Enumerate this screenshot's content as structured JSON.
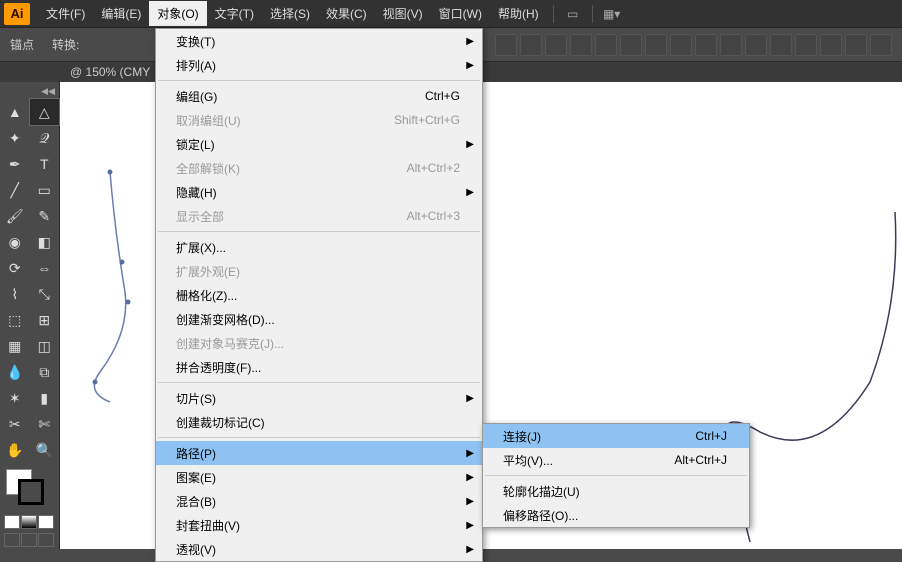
{
  "app_logo": "Ai",
  "menubar": [
    "文件(F)",
    "编辑(E)",
    "对象(O)",
    "文字(T)",
    "选择(S)",
    "效果(C)",
    "视图(V)",
    "窗口(W)",
    "帮助(H)"
  ],
  "active_menu_index": 2,
  "options": {
    "anchor": "锚点",
    "convert": "转换:"
  },
  "doc_tab": {
    "label": "@ 150% (CMY",
    "close": "×"
  },
  "dropdown": [
    {
      "t": "item",
      "label": "变换(T)",
      "arrow": true
    },
    {
      "t": "item",
      "label": "排列(A)",
      "arrow": true
    },
    {
      "t": "sep"
    },
    {
      "t": "item",
      "label": "编组(G)",
      "sc": "Ctrl+G"
    },
    {
      "t": "item",
      "label": "取消编组(U)",
      "sc": "Shift+Ctrl+G",
      "disabled": true
    },
    {
      "t": "item",
      "label": "锁定(L)",
      "arrow": true
    },
    {
      "t": "item",
      "label": "全部解锁(K)",
      "sc": "Alt+Ctrl+2",
      "disabled": true
    },
    {
      "t": "item",
      "label": "隐藏(H)",
      "arrow": true
    },
    {
      "t": "item",
      "label": "显示全部",
      "sc": "Alt+Ctrl+3",
      "disabled": true
    },
    {
      "t": "sep"
    },
    {
      "t": "item",
      "label": "扩展(X)..."
    },
    {
      "t": "item",
      "label": "扩展外观(E)",
      "disabled": true
    },
    {
      "t": "item",
      "label": "栅格化(Z)..."
    },
    {
      "t": "item",
      "label": "创建渐变网格(D)..."
    },
    {
      "t": "item",
      "label": "创建对象马赛克(J)...",
      "disabled": true
    },
    {
      "t": "item",
      "label": "拼合透明度(F)..."
    },
    {
      "t": "sep"
    },
    {
      "t": "item",
      "label": "切片(S)",
      "arrow": true
    },
    {
      "t": "item",
      "label": "创建裁切标记(C)"
    },
    {
      "t": "sep"
    },
    {
      "t": "item",
      "label": "路径(P)",
      "arrow": true,
      "hl": true
    },
    {
      "t": "item",
      "label": "图案(E)",
      "arrow": true
    },
    {
      "t": "item",
      "label": "混合(B)",
      "arrow": true
    },
    {
      "t": "item",
      "label": "封套扭曲(V)",
      "arrow": true
    },
    {
      "t": "item",
      "label": "透视(V)",
      "arrow": true
    }
  ],
  "submenu": [
    {
      "t": "item",
      "label": "连接(J)",
      "sc": "Ctrl+J",
      "hl": true
    },
    {
      "t": "item",
      "label": "平均(V)...",
      "sc": "Alt+Ctrl+J"
    },
    {
      "t": "sep"
    },
    {
      "t": "item",
      "label": "轮廓化描边(U)"
    },
    {
      "t": "item",
      "label": "偏移路径(O)..."
    }
  ],
  "tools": [
    [
      "select",
      "direct"
    ],
    [
      "wand",
      "lasso"
    ],
    [
      "pen",
      "type"
    ],
    [
      "line",
      "rect"
    ],
    [
      "brush",
      "pencil"
    ],
    [
      "blob",
      "eraser"
    ],
    [
      "rotate",
      "width"
    ],
    [
      "warp",
      "free"
    ],
    [
      "shape",
      "graph"
    ],
    [
      "mesh",
      "gradient"
    ],
    [
      "eyedrop",
      "blend"
    ],
    [
      "symbol",
      "column"
    ],
    [
      "artboard",
      "slice"
    ],
    [
      "hand",
      "zoom"
    ]
  ],
  "colors": {
    "ui_bg": "#4a4a4a",
    "menu_bg": "#f0f0f0",
    "highlight": "#8ec2f2",
    "accent": "#ff9a00"
  }
}
